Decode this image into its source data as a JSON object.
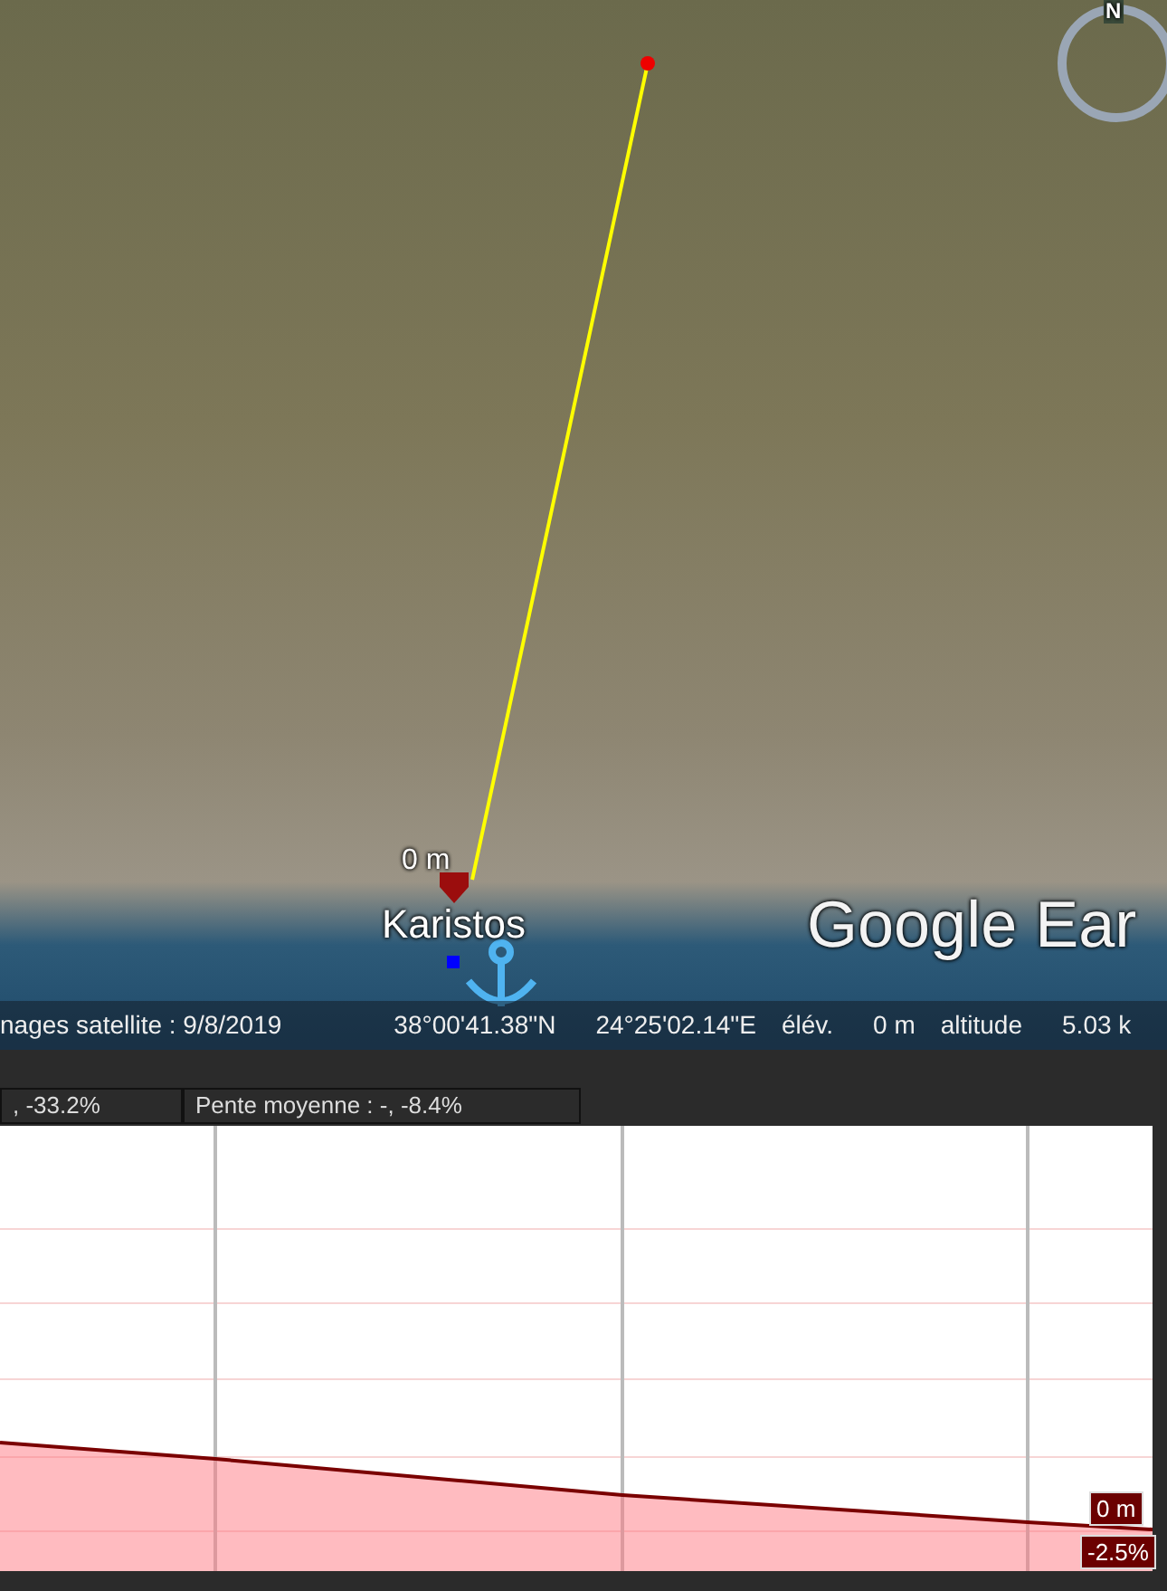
{
  "map": {
    "place_label": "Karistos",
    "distance_label": "0 m",
    "logo_text": "Google Ear",
    "compass_label": "N"
  },
  "status_bar": {
    "imagery_date": "nages satellite : 9/8/2019",
    "latitude": "38°00'41.38\"N",
    "longitude": "24°25'02.14\"E",
    "elevation_label": "élév.",
    "elevation": "0 m",
    "altitude_label": "altitude",
    "altitude": "5.03 k"
  },
  "stats": [
    {
      "text": ", -33.2%"
    },
    {
      "text": "Pente moyenne : -, -8.4%"
    }
  ],
  "profile": {
    "elevation_marker": "0 m",
    "slope_marker": "-2.5%"
  }
}
